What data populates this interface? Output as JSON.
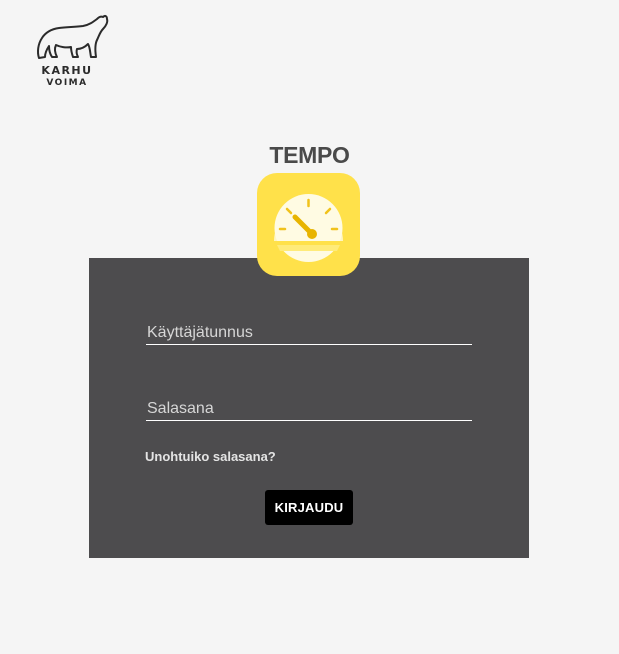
{
  "brand": {
    "logo_line1": "KARHU",
    "logo_line2": "VOIMA"
  },
  "app": {
    "title": "TEMPO",
    "icon": "speedometer-icon",
    "icon_color": "#ffe14a"
  },
  "login": {
    "username_placeholder": "Käyttäjätunnus",
    "password_placeholder": "Salasana",
    "forgot_label": "Unohtuiko salasana?",
    "submit_label": "KIRJAUDU"
  },
  "colors": {
    "background": "#f5f5f5",
    "card": "#4d4c4e",
    "button": "#000000",
    "accent": "#ffe14a"
  }
}
